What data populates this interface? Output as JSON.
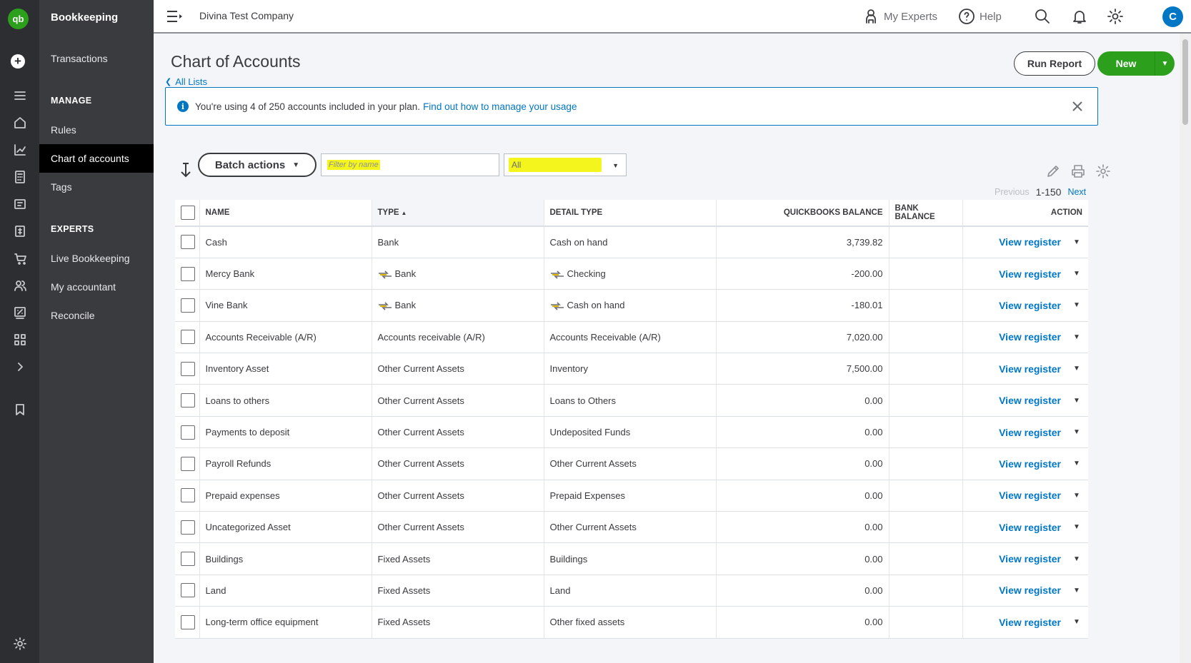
{
  "app": {
    "logo_text": "qb",
    "section_title": "Bookkeeping"
  },
  "menu": {
    "items_top": [
      {
        "label": "Transactions"
      }
    ],
    "manage_heading": "MANAGE",
    "manage_items": [
      {
        "label": "Rules"
      },
      {
        "label": "Chart of accounts",
        "active": true
      },
      {
        "label": "Tags"
      }
    ],
    "experts_heading": "EXPERTS",
    "experts_items": [
      {
        "label": "Live Bookkeeping"
      },
      {
        "label": "My accountant"
      },
      {
        "label": "Reconcile"
      }
    ]
  },
  "topbar": {
    "company": "Divina Test Company",
    "my_experts": "My Experts",
    "help": "Help",
    "avatar_initial": "C"
  },
  "page": {
    "title": "Chart of Accounts",
    "back_link": "All Lists",
    "run_report": "Run Report",
    "new_label": "New"
  },
  "banner": {
    "text": "You're using 4 of 250 accounts included in your plan.",
    "link": "Find out how to manage your usage"
  },
  "toolbar": {
    "batch_actions": "Batch actions",
    "filter_placeholder": "Filter by name",
    "type_filter_value": "All",
    "pager_prev": "Previous",
    "pager_range": "1-150",
    "pager_next": "Next"
  },
  "table": {
    "headers": {
      "name": "NAME",
      "type": "TYPE",
      "detail_type": "DETAIL TYPE",
      "qb_balance": "QUICKBOOKS BALANCE",
      "bank_balance": "BANK BALANCE",
      "action": "ACTION"
    },
    "action_label": "View register",
    "rows": [
      {
        "name": "Cash",
        "type": "Bank",
        "detail": "Cash on hand",
        "qb_balance": "3,739.82",
        "bank_balance": "",
        "linked": false
      },
      {
        "name": "Mercy Bank",
        "type": "Bank",
        "detail": "Checking",
        "qb_balance": "-200.00",
        "bank_balance": "",
        "linked": true
      },
      {
        "name": "Vine Bank",
        "type": "Bank",
        "detail": "Cash on hand",
        "qb_balance": "-180.01",
        "bank_balance": "",
        "linked": true
      },
      {
        "name": "Accounts Receivable (A/R)",
        "type": "Accounts receivable (A/R)",
        "detail": "Accounts Receivable (A/R)",
        "qb_balance": "7,020.00",
        "bank_balance": "",
        "linked": false
      },
      {
        "name": "Inventory Asset",
        "type": "Other Current Assets",
        "detail": "Inventory",
        "qb_balance": "7,500.00",
        "bank_balance": "",
        "linked": false
      },
      {
        "name": "Loans to others",
        "type": "Other Current Assets",
        "detail": "Loans to Others",
        "qb_balance": "0.00",
        "bank_balance": "",
        "linked": false
      },
      {
        "name": "Payments to deposit",
        "type": "Other Current Assets",
        "detail": "Undeposited Funds",
        "qb_balance": "0.00",
        "bank_balance": "",
        "linked": false
      },
      {
        "name": "Payroll Refunds",
        "type": "Other Current Assets",
        "detail": "Other Current Assets",
        "qb_balance": "0.00",
        "bank_balance": "",
        "linked": false
      },
      {
        "name": "Prepaid expenses",
        "type": "Other Current Assets",
        "detail": "Prepaid Expenses",
        "qb_balance": "0.00",
        "bank_balance": "",
        "linked": false
      },
      {
        "name": "Uncategorized Asset",
        "type": "Other Current Assets",
        "detail": "Other Current Assets",
        "qb_balance": "0.00",
        "bank_balance": "",
        "linked": false
      },
      {
        "name": "Buildings",
        "type": "Fixed Assets",
        "detail": "Buildings",
        "qb_balance": "0.00",
        "bank_balance": "",
        "linked": false
      },
      {
        "name": "Land",
        "type": "Fixed Assets",
        "detail": "Land",
        "qb_balance": "0.00",
        "bank_balance": "",
        "linked": false
      },
      {
        "name": "Long-term office equipment",
        "type": "Fixed Assets",
        "detail": "Other fixed assets",
        "qb_balance": "0.00",
        "bank_balance": "",
        "linked": false
      }
    ]
  },
  "colors": {
    "brand_green": "#2ca01c",
    "link_blue": "#0077c5",
    "highlight_yellow": "#f3f51c",
    "rail_bg": "#2d2e31",
    "menu_bg": "#3a3b3f"
  }
}
